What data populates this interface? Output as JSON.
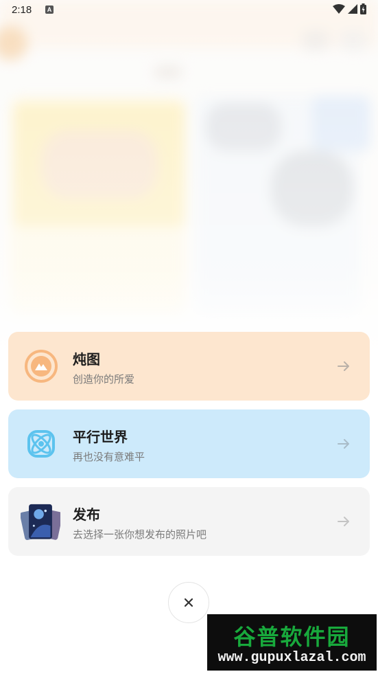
{
  "status_bar": {
    "time": "2:18",
    "notification_badge": "A"
  },
  "options": [
    {
      "title": "炖图",
      "subtitle": "创造你的所爱",
      "icon": "mountain-circle-icon"
    },
    {
      "title": "平行世界",
      "subtitle": "再也没有意难平",
      "icon": "atom-icon"
    },
    {
      "title": "发布",
      "subtitle": "去选择一张你想发布的照片吧",
      "icon": "photo-stack-icon"
    }
  ],
  "close_glyph": "×",
  "watermark": {
    "title": "谷普软件园",
    "url": "www.gupuxlazal.com"
  },
  "colors": {
    "dunt_card": "#fde6cf",
    "parallel_card": "#cdeafb",
    "publish_card": "#f4f4f4",
    "dunt_accent": "#f7b77f",
    "parallel_accent": "#5cc3ee",
    "watermark_green": "#18a93c"
  }
}
